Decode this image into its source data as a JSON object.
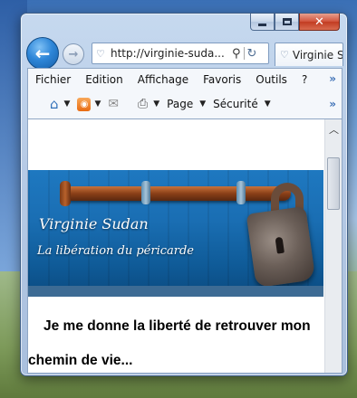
{
  "window": {
    "caption_buttons": {
      "minimize_icon": "minimize-icon",
      "maximize_icon": "maximize-icon",
      "close_glyph": "✕"
    }
  },
  "address_bar": {
    "back_glyph": "←",
    "forward_glyph": "→",
    "url": "http://virginie-suda...",
    "search_glyph": "⚲",
    "refresh_glyph": "↻"
  },
  "tab": {
    "label": "Virginie S"
  },
  "menubar": {
    "items": [
      "Fichier",
      "Edition",
      "Affichage",
      "Favoris",
      "Outils",
      "?"
    ],
    "overflow": "»"
  },
  "command_bar": {
    "page_label": "Page",
    "security_label": "Sécurité",
    "overflow": "»"
  },
  "page": {
    "banner_title": "Virginie Sudan",
    "banner_subtitle": "La libération du péricarde",
    "lead_text": "Je me donne la liberté de retrouver mon chemin de vie..."
  },
  "colors": {
    "accent": "#2e86d8",
    "close_red": "#c23c22",
    "banner_blue": "#1a6eb3"
  }
}
